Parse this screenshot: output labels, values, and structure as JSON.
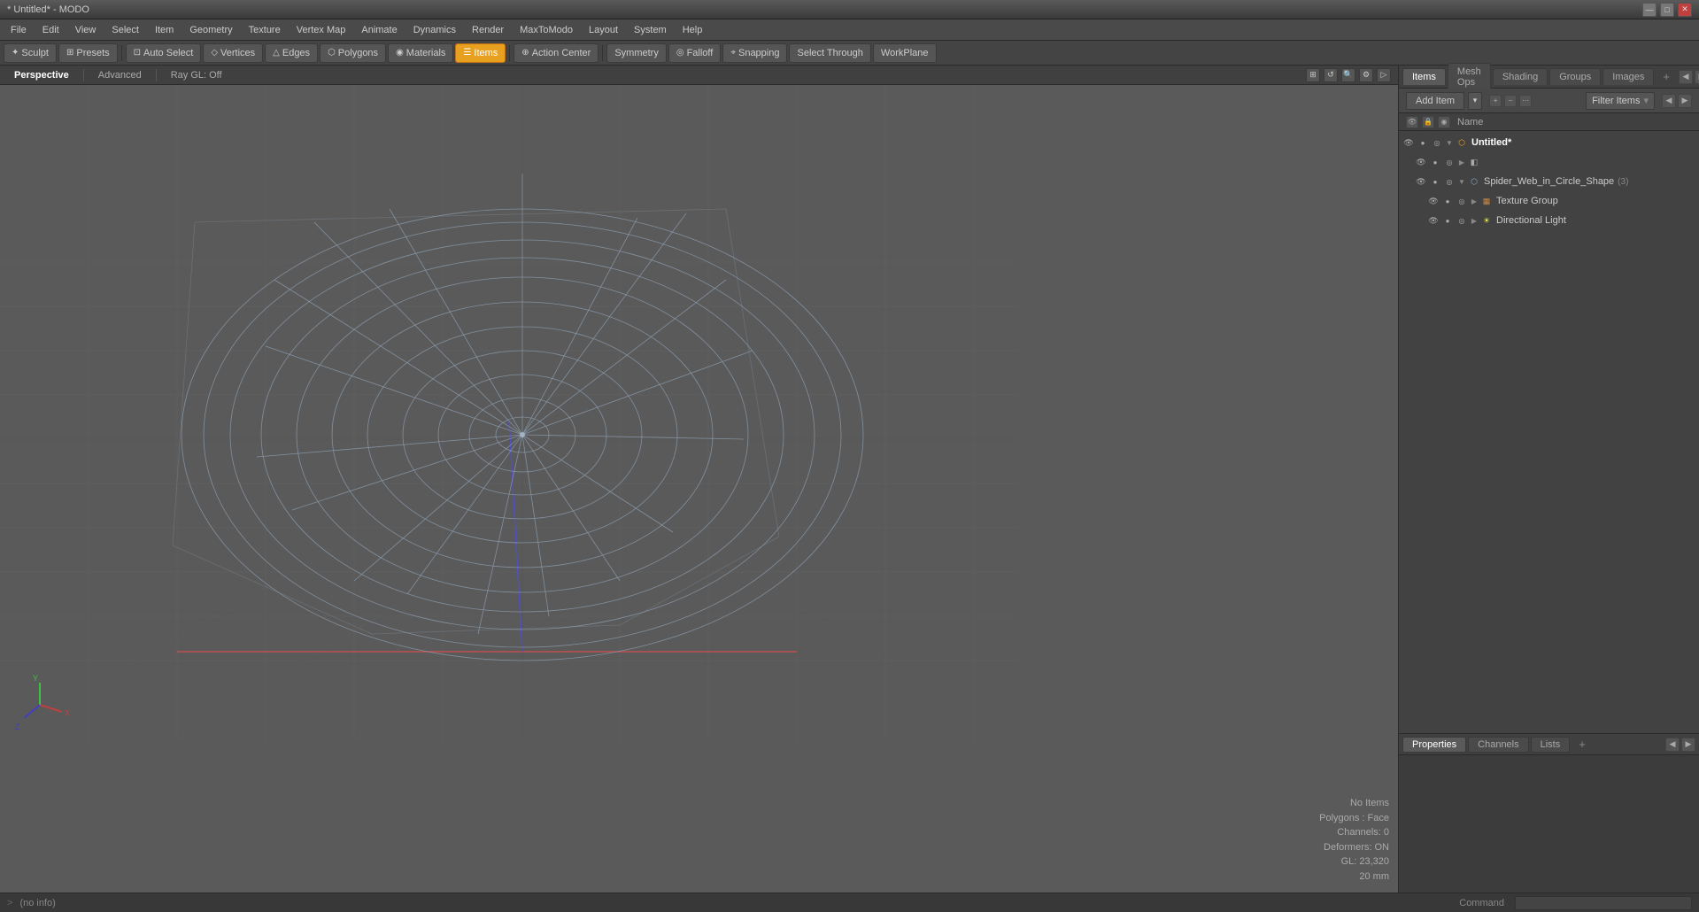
{
  "titlebar": {
    "title": "* Untitled* - MODO",
    "controls": {
      "minimize": "—",
      "restore": "□",
      "close": "✕"
    }
  },
  "menubar": {
    "items": [
      "File",
      "Edit",
      "View",
      "Select",
      "Item",
      "Geometry",
      "Texture",
      "Vertex Map",
      "Animate",
      "Dynamics",
      "Render",
      "MaxToModo",
      "Layout",
      "System",
      "Help"
    ]
  },
  "toolbar": {
    "sculpt": "Sculpt",
    "presets": "Presets",
    "auto_select": "Auto Select",
    "vertices": "Vertices",
    "edges": "Edges",
    "polygons": "Polygons",
    "materials": "Materials",
    "items": "Items",
    "action_center": "Action Center",
    "symmetry": "Symmetry",
    "falloff": "Falloff",
    "snapping": "Snapping",
    "select_through": "Select Through",
    "workplane": "WorkPlane"
  },
  "viewport": {
    "tabs": [
      "Perspective",
      "Advanced"
    ],
    "ray_gl": "Ray GL: Off",
    "status": {
      "no_items": "No Items",
      "polygons": "Polygons : Face",
      "channels": "Channels: 0",
      "deformers": "Deformers: ON",
      "gl": "GL: 23,320",
      "unit": "20 mm"
    }
  },
  "right_panel": {
    "tabs": [
      "Items",
      "Mesh Ops",
      "Shading",
      "Groups",
      "Images",
      "+"
    ],
    "add_item": "Add Item",
    "filter_items": "Filter Items",
    "col_header": "Name",
    "tree": [
      {
        "level": 0,
        "label": "Untitled*",
        "icon": "mesh",
        "expanded": true,
        "type": "root"
      },
      {
        "level": 1,
        "label": "",
        "icon": "mesh-sub",
        "expanded": false,
        "type": "sub"
      },
      {
        "level": 1,
        "label": "Spider_Web_in_Circle_Shape",
        "icon": "mesh",
        "count": "(3)",
        "expanded": true,
        "type": "mesh"
      },
      {
        "level": 2,
        "label": "Texture Group",
        "icon": "texture",
        "expanded": false,
        "type": "group"
      },
      {
        "level": 2,
        "label": "Directional Light",
        "icon": "light",
        "expanded": false,
        "type": "light"
      }
    ]
  },
  "bottom_panel": {
    "tabs": [
      "Properties",
      "Channels",
      "Lists",
      "+"
    ]
  },
  "statusbar": {
    "arrow": ">",
    "info": "(no info)",
    "command_label": "Command"
  }
}
